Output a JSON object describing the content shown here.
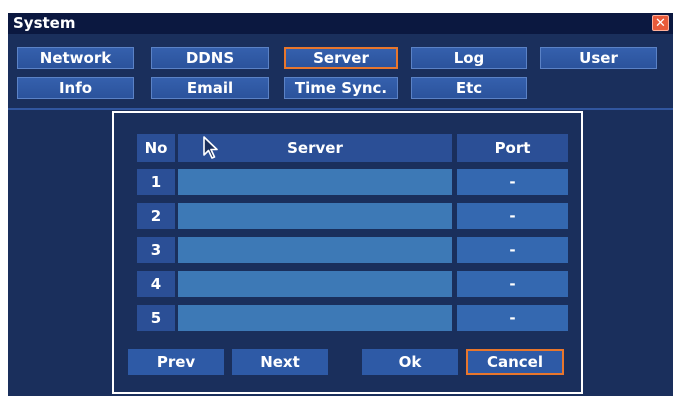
{
  "window": {
    "title": "System",
    "close_icon": "close-icon"
  },
  "tabs": [
    {
      "label": "Network"
    },
    {
      "label": "DDNS"
    },
    {
      "label": "Server"
    },
    {
      "label": "Log"
    },
    {
      "label": "User"
    },
    {
      "label": "Info"
    },
    {
      "label": "Email"
    },
    {
      "label": "Time Sync."
    },
    {
      "label": "Etc"
    }
  ],
  "table": {
    "headers": {
      "no": "No",
      "server": "Server",
      "port": "Port"
    },
    "rows": [
      {
        "no": "1",
        "server": "",
        "port": "-"
      },
      {
        "no": "2",
        "server": "",
        "port": "-"
      },
      {
        "no": "3",
        "server": "",
        "port": "-"
      },
      {
        "no": "4",
        "server": "",
        "port": "-"
      },
      {
        "no": "5",
        "server": "",
        "port": "-"
      }
    ]
  },
  "buttons": {
    "prev": "Prev",
    "next": "Next",
    "ok": "Ok",
    "cancel": "Cancel"
  },
  "colors": {
    "accent": "#e8762c",
    "background": "#1a2f5c",
    "titlebar": "#0b1840"
  }
}
